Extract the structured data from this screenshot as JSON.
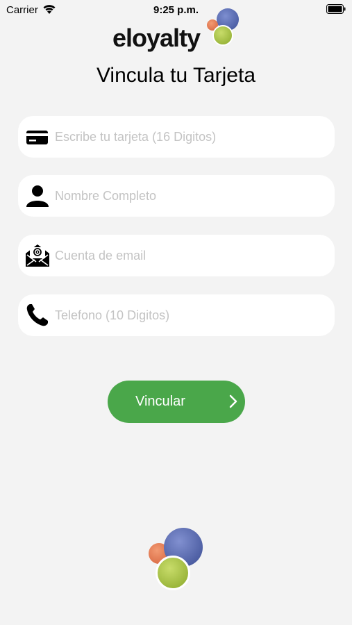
{
  "status_bar": {
    "carrier": "Carrier",
    "time": "9:25 p.m."
  },
  "brand": {
    "logo_text": "eloyalty"
  },
  "page": {
    "title": "Vincula tu Tarjeta"
  },
  "form": {
    "card_placeholder": "Escribe tu tarjeta (16 Digitos)",
    "name_placeholder": "Nombre Completo",
    "email_placeholder": "Cuenta de email",
    "phone_placeholder": "Telefono (10 Digitos)"
  },
  "actions": {
    "submit_label": "Vincular"
  },
  "icons": {
    "wifi": "wifi-icon",
    "battery": "battery-icon",
    "card": "credit-card-icon",
    "person": "person-icon",
    "email": "email-icon",
    "phone": "phone-icon",
    "chevron": "chevron-right-icon"
  },
  "colors": {
    "background": "#f3f3f3",
    "field": "#ffffff",
    "accent": "#4aa74a",
    "placeholder": "#c3c3c3",
    "logo_blue": "#5568a8",
    "logo_orange": "#e07a4e",
    "logo_green": "#a6c23a"
  }
}
